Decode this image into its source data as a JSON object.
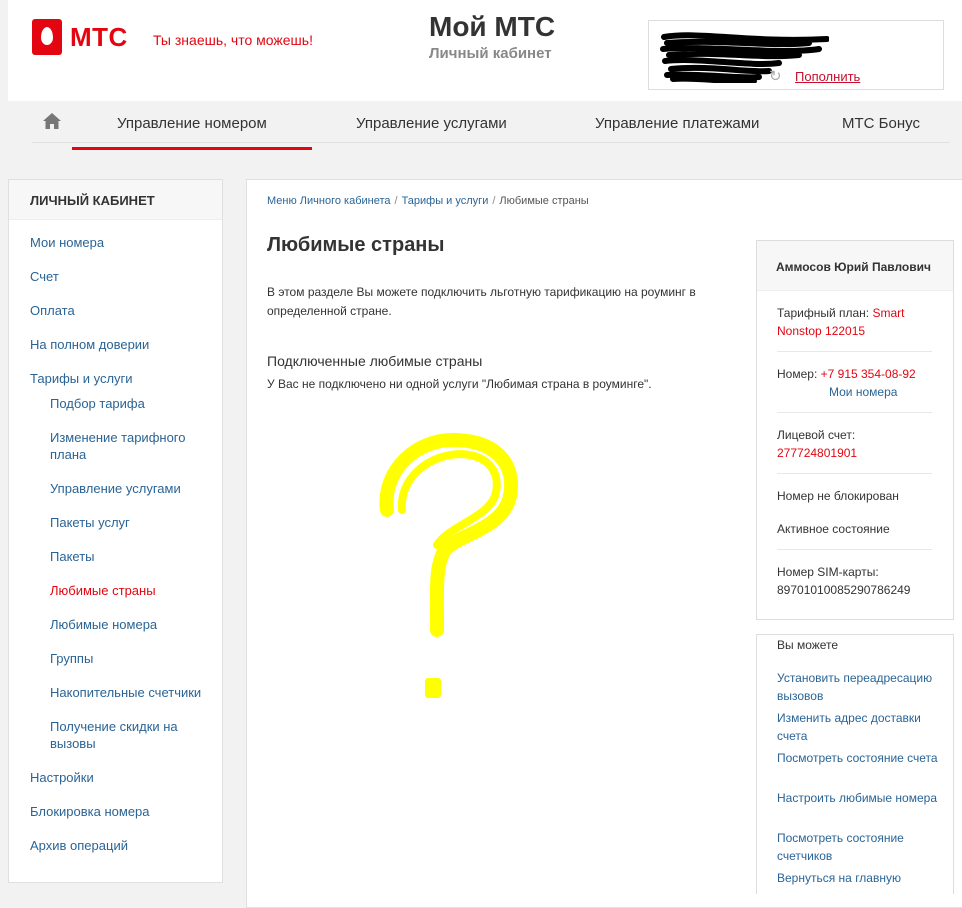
{
  "header": {
    "logo_text": "МТС",
    "slogan": "Ты знаешь, что можешь!",
    "title": "Мой МТС",
    "subtitle": "Личный кабинет",
    "topup_label": "Пополнить"
  },
  "nav": {
    "items": [
      {
        "label": "Управление номером",
        "active": true
      },
      {
        "label": "Управление услугами",
        "active": false
      },
      {
        "label": "Управление платежами",
        "active": false
      },
      {
        "label": "МТС Бонус",
        "active": false
      }
    ]
  },
  "sidebar": {
    "heading": "ЛИЧНЫЙ КАБИНЕТ",
    "items": [
      {
        "label": "Мои номера"
      },
      {
        "label": "Счет"
      },
      {
        "label": "Оплата"
      },
      {
        "label": "На полном доверии"
      },
      {
        "label": "Тарифы и услуги"
      },
      {
        "label": "Подбор тарифа"
      },
      {
        "label": "Изменение тарифного плана"
      },
      {
        "label": "Управление услугами"
      },
      {
        "label": "Пакеты услуг"
      },
      {
        "label": "Пакеты"
      },
      {
        "label": "Любимые страны"
      },
      {
        "label": "Любимые номера"
      },
      {
        "label": "Группы"
      },
      {
        "label": "Накопительные счетчики"
      },
      {
        "label": "Получение скидки на вызовы"
      },
      {
        "label": "Настройки"
      },
      {
        "label": "Блокировка номера"
      },
      {
        "label": "Архив операций"
      }
    ],
    "active_item": "Любимые страны"
  },
  "breadcrumb": {
    "items": [
      "Меню Личного кабинета",
      "Тарифы и услуги"
    ],
    "separator": "/",
    "current": "Любимые страны"
  },
  "main": {
    "title": "Любимые страны",
    "intro": "В этом разделе Вы можете подключить льготную тарификацию на роуминг в определенной стране.",
    "section_title": "Подключенные любимые страны",
    "section_text": "У Вас не подключено ни одной услуги \"Любимая страна в роуминге\"."
  },
  "user": {
    "name": "Аммосов Юрий Павлович",
    "tariff_label": "Тарифный план:",
    "tariff_value": "Smart Nonstop 122015",
    "number_label": "Номер:",
    "number_value": "+7 915 354-08-92",
    "my_numbers_link": "Мои номера",
    "account_label": "Лицевой счет:",
    "account_value": "277724801901",
    "block_status": "Номер не блокирован",
    "state": "Активное состояние",
    "sim_label": "Номер SIM-карты:",
    "sim_value": "89701010085290786249"
  },
  "actions": {
    "title": "Вы можете",
    "links": [
      "Установить переадресацию вызовов",
      "Изменить адрес доставки счета",
      "Посмотреть состояние счета",
      "Настроить любимые номера",
      "Посмотреть состояние счетчиков",
      "Вернуться на главную"
    ]
  },
  "colors": {
    "brand_red": "#e30611",
    "link_blue": "#2a6496",
    "scribble_yellow": "#ffff00"
  }
}
